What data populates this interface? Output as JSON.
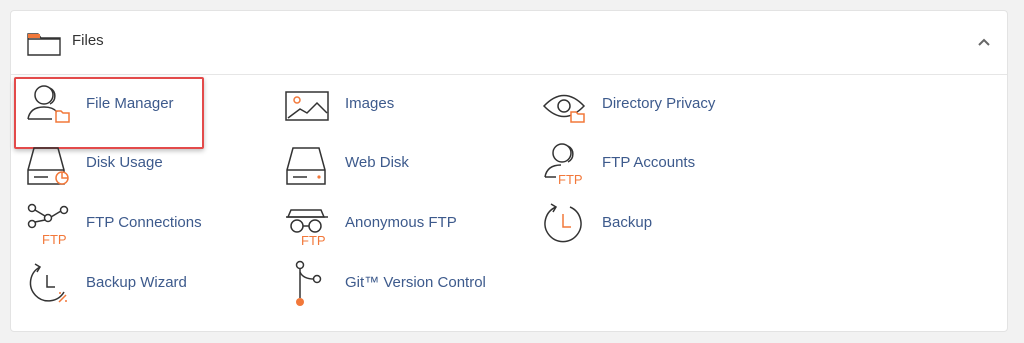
{
  "section": {
    "title": "Files",
    "icon": "folder-icon",
    "collapse_icon": "chevron-up-icon"
  },
  "colors": {
    "link": "#3d5a8c",
    "icon_stroke": "#333333",
    "accent": "#f2783a",
    "highlight_border": "#e34a4a"
  },
  "items": [
    {
      "label": "File Manager",
      "icon": "file-manager-icon",
      "highlighted": true
    },
    {
      "label": "Images",
      "icon": "images-icon"
    },
    {
      "label": "Directory Privacy",
      "icon": "directory-privacy-icon"
    },
    {
      "label": "Disk Usage",
      "icon": "disk-usage-icon"
    },
    {
      "label": "Web Disk",
      "icon": "web-disk-icon"
    },
    {
      "label": "FTP Accounts",
      "icon": "ftp-accounts-icon",
      "icon_text": "FTP"
    },
    {
      "label": "FTP Connections",
      "icon": "ftp-connections-icon",
      "icon_text": "FTP"
    },
    {
      "label": "Anonymous FTP",
      "icon": "anonymous-ftp-icon",
      "icon_text": "FTP"
    },
    {
      "label": "Backup",
      "icon": "backup-icon"
    },
    {
      "label": "Backup Wizard",
      "icon": "backup-wizard-icon"
    },
    {
      "label": "Git™ Version Control",
      "icon": "git-version-control-icon"
    }
  ]
}
